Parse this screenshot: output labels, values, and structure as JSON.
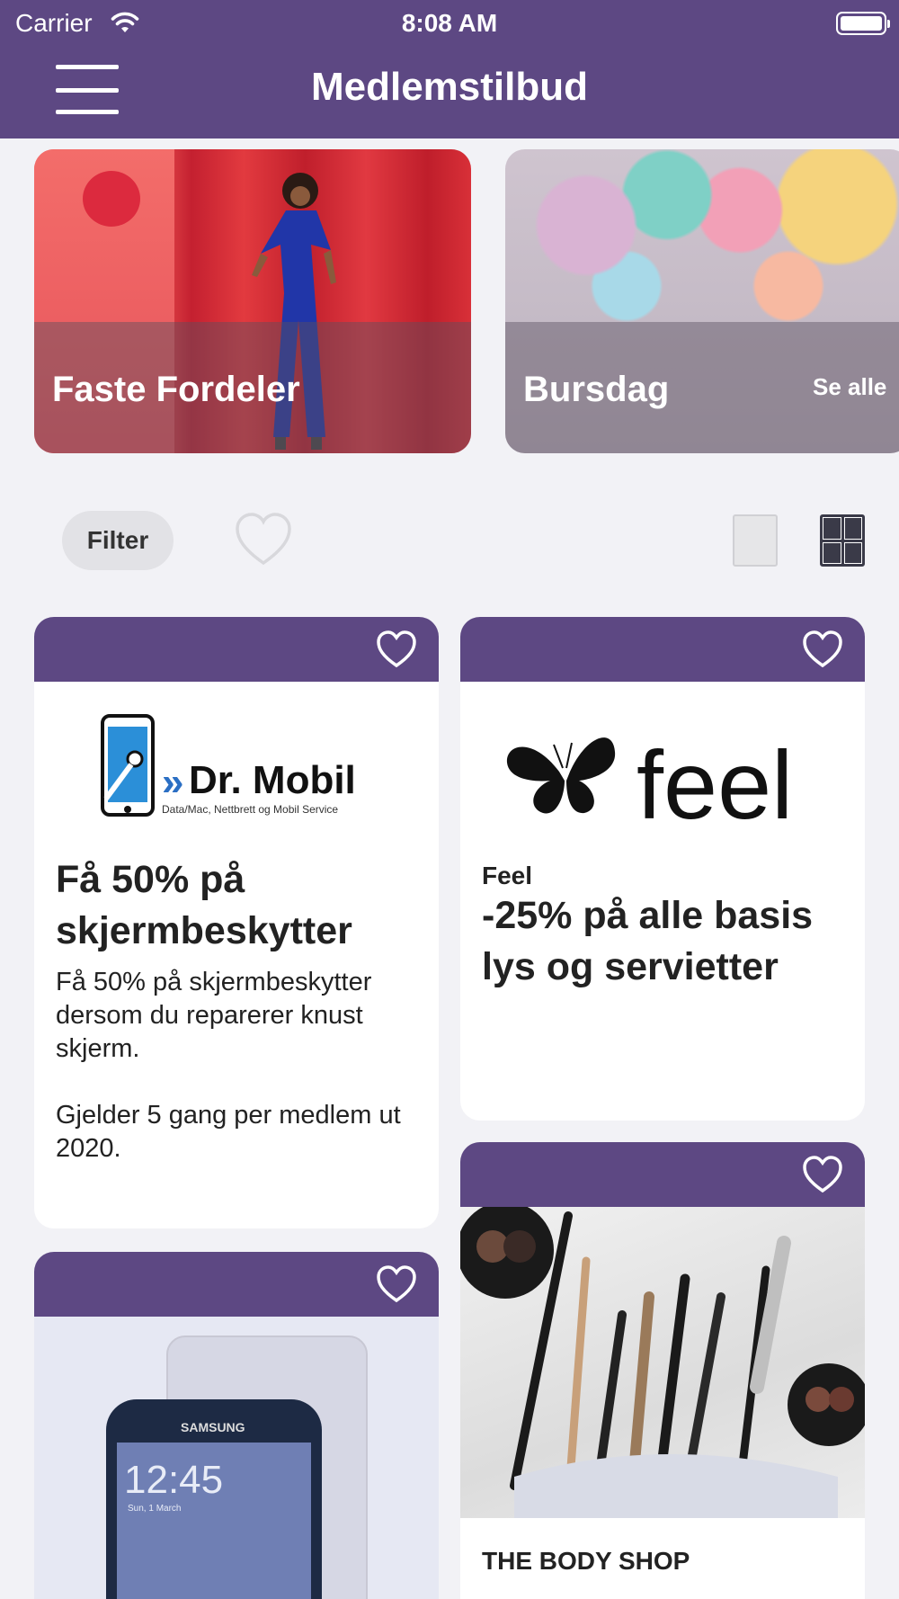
{
  "status_bar": {
    "carrier": "Carrier",
    "time": "8:08 AM"
  },
  "header": {
    "title": "Medlemstilbud"
  },
  "banners": [
    {
      "title": "Faste Fordeler"
    },
    {
      "title": "Bursdag",
      "see_all": "Se alle"
    }
  ],
  "toolbar": {
    "filter_label": "Filter"
  },
  "offers": [
    {
      "logo_text": "Dr. Mobil",
      "logo_sub": "Data/Mac, Nettbrett og Mobil Service",
      "headline": "Få 50% på skjermbeskytter",
      "description": "Få 50% på skjermbeskytter dersom du reparerer knust skjerm.",
      "note": "Gjelder 5 gang per medlem ut 2020."
    },
    {
      "logo_text": "feel",
      "brand": "Feel",
      "headline": "-25% på alle basis lys og servietter"
    },
    {
      "phone_brand": "SAMSUNG",
      "phone_time": "12:45",
      "phone_date": "Sun, 1 March"
    },
    {
      "brand": "THE BODY SHOP"
    }
  ],
  "colors": {
    "brand_purple": "#5d4883",
    "background": "#f2f2f6"
  },
  "icons": [
    "wifi-icon",
    "battery-icon",
    "menu-icon",
    "heart-icon",
    "single-view-icon",
    "grid-view-icon"
  ]
}
